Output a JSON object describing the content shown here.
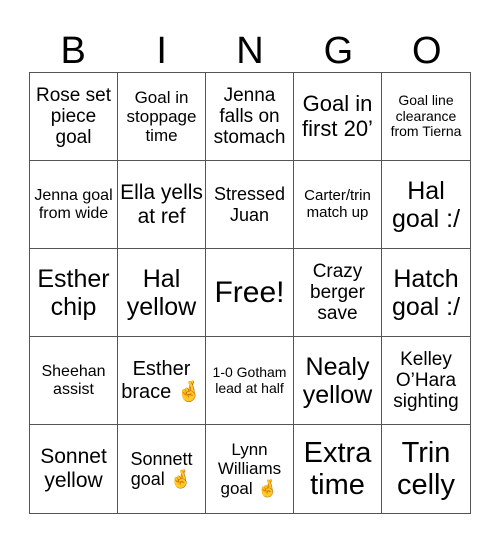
{
  "header": {
    "letters": [
      "B",
      "I",
      "N",
      "G",
      "O"
    ]
  },
  "cells": [
    {
      "text": "Rose set piece goal",
      "size": 19
    },
    {
      "text": "Goal in stoppage time",
      "size": 17
    },
    {
      "text": "Jenna falls on stomach",
      "size": 19
    },
    {
      "text": "Goal in first 20’",
      "size": 22
    },
    {
      "text": "Goal line clearance from Tierna",
      "size": 14
    },
    {
      "text": "Jenna goal from wide",
      "size": 16
    },
    {
      "text": "Ella yells at ref",
      "size": 21
    },
    {
      "text": "Stressed Juan",
      "size": 18
    },
    {
      "text": "Carter/trin match up",
      "size": 15
    },
    {
      "text": "Hal goal :/",
      "size": 25
    },
    {
      "text": "Esther chip",
      "size": 25
    },
    {
      "text": "Hal yellow",
      "size": 25
    },
    {
      "text": "Free!",
      "size": 30
    },
    {
      "text": "Crazy berger save",
      "size": 19
    },
    {
      "text": "Hatch goal :/",
      "size": 25
    },
    {
      "text": "Sheehan assist",
      "size": 16
    },
    {
      "text": "Esther brace 🤞",
      "size": 20
    },
    {
      "text": "1-0 Gotham lead at half",
      "size": 14
    },
    {
      "text": "Nealy yellow",
      "size": 25
    },
    {
      "text": "Kelley O’Hara sighting",
      "size": 19
    },
    {
      "text": "Sonnet yellow",
      "size": 21
    },
    {
      "text": "Sonnett goal 🤞",
      "size": 18
    },
    {
      "text": "Lynn Williams goal 🤞",
      "size": 17
    },
    {
      "text": "Extra time",
      "size": 29
    },
    {
      "text": "Trin celly",
      "size": 29
    }
  ]
}
